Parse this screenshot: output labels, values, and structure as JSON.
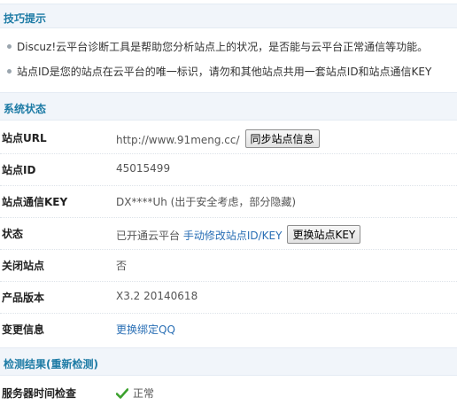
{
  "tips": {
    "title": "技巧提示",
    "items": [
      "Discuz!云平台诊断工具是帮助您分析站点上的状况，是否能与云平台正常通信等功能。",
      "站点ID是您的站点在云平台的唯一标识，请勿和其他站点共用一套站点ID和站点通信KEY"
    ]
  },
  "status": {
    "title": "系统状态",
    "site_url": {
      "label": "站点URL",
      "value": "http://www.91meng.cc/",
      "button": "同步站点信息"
    },
    "site_id": {
      "label": "站点ID",
      "value": "45015499"
    },
    "site_key": {
      "label": "站点通信KEY",
      "value": "DX****Uh (出于安全考虑，部分隐藏)"
    },
    "state": {
      "label": "状态",
      "value": "已开通云平台",
      "link": "手动修改站点ID/KEY",
      "button": "更换站点KEY"
    },
    "closed": {
      "label": "关闭站点",
      "value": "否"
    },
    "version": {
      "label": "产品版本",
      "value": "X3.2 20140618"
    },
    "change": {
      "label": "变更信息",
      "link": "更换绑定QQ"
    }
  },
  "results": {
    "title": "检测结果(重新检测)",
    "time_check": {
      "label": "服务器时间检查",
      "icon": "check-icon",
      "value": "正常"
    }
  },
  "colors": {
    "section_title": "#1d7ba5",
    "link": "#2a6fb5",
    "check": "#3ca12e"
  }
}
